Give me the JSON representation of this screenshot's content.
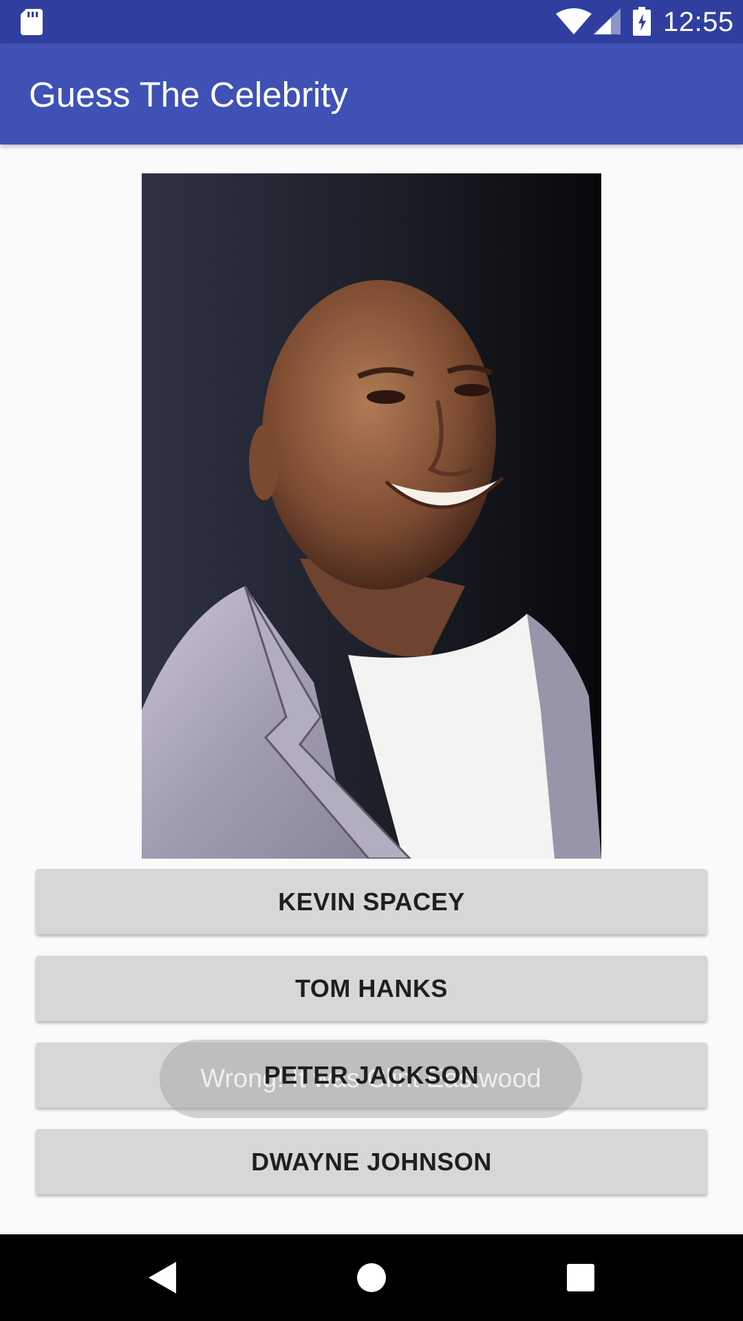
{
  "status_bar": {
    "time": "12:55",
    "icons": [
      "sd-card-icon",
      "wifi-icon",
      "signal-icon",
      "battery-icon"
    ]
  },
  "app_bar": {
    "title": "Guess The Celebrity"
  },
  "image": {
    "subject": "celebrity-photo"
  },
  "answers": [
    {
      "label": "KEVIN SPACEY"
    },
    {
      "label": "TOM HANKS"
    },
    {
      "label": "PETER JACKSON"
    },
    {
      "label": "DWAYNE JOHNSON"
    }
  ],
  "toast": {
    "message": "Wrong! It was Clint Eastwood"
  },
  "nav_bar": {
    "icons": [
      "back-icon",
      "home-icon",
      "recents-icon"
    ]
  },
  "colors": {
    "status_bar": "#303f9f",
    "app_bar": "#3f51b5",
    "button": "#d6d7d7",
    "background": "#fafafa"
  }
}
